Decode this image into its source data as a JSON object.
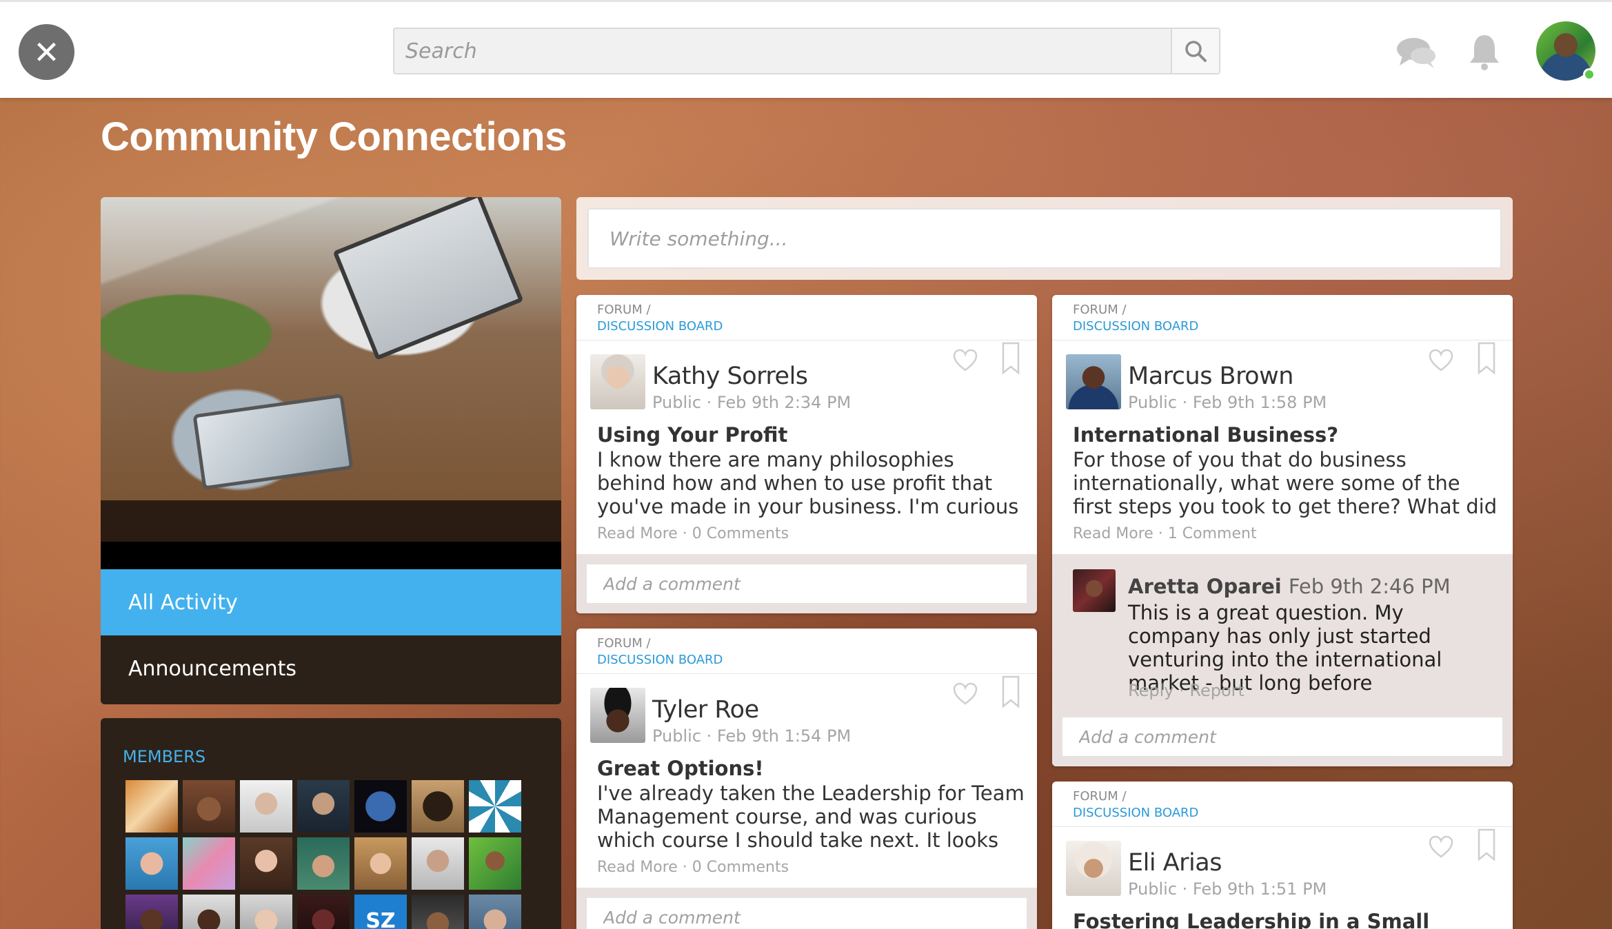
{
  "header": {
    "close_glyph": "✕",
    "search_placeholder": "Search"
  },
  "page_title": "Community Connections",
  "sidebar": {
    "nav": [
      {
        "label": "All Activity",
        "active": true
      },
      {
        "label": "Announcements",
        "active": false
      }
    ],
    "members_title": "MEMBERS",
    "member_initials_badge": "SZ"
  },
  "composer": {
    "placeholder": "Write something..."
  },
  "posts": [
    {
      "forum_label": "FORUM /",
      "board": "DISCUSSION BOARD",
      "author": "Kathy Sorrels",
      "meta": "Public · Feb 9th 2:34 PM",
      "title": "Using Your Profit",
      "body": "I know there are many philosophies behind how and when to use profit that you've made in your business. I'm curious what you",
      "links": "Read More · 0 Comments",
      "comment_placeholder": "Add a comment"
    },
    {
      "forum_label": "FORUM /",
      "board": "DISCUSSION BOARD",
      "author": "Tyler Roe",
      "meta": "Public · Feb 9th 1:54 PM",
      "title": "Great Options!",
      "body": "I've already taken the Leadership for Team Management course, and was curious which course I should take next. It looks like there's",
      "links": "Read More · 0 Comments",
      "comment_placeholder": "Add a comment"
    },
    {
      "forum_label": "FORUM /",
      "board": "DISCUSSION BOARD",
      "author": "Marcus Brown",
      "meta": "Public · Feb 9th 1:58 PM",
      "title": "International Business?",
      "body": "For those of you that do business internationally, what were some of the first steps you took to get there? What did you",
      "links": "Read More · 1 Comment",
      "reply": {
        "name": "Aretta Oparei",
        "time": "Feb 9th 2:46 PM",
        "body": "This is a great question. My company has only just started venturing into the international market - but long before",
        "links": "Reply · Report"
      },
      "comment_placeholder": "Add a comment"
    },
    {
      "forum_label": "FORUM /",
      "board": "DISCUSSION BOARD",
      "author": "Eli Arias",
      "meta": "Public · Feb 9th 1:51 PM",
      "title": "Fostering Leadership in a Small Business"
    }
  ],
  "icons": {
    "close": "close-icon",
    "search": "search-icon",
    "chat": "chat-icon",
    "notifications": "bell-icon",
    "like": "heart-icon",
    "save": "bookmark-icon"
  },
  "colors": {
    "accent": "#43b1ed",
    "link": "#2a9ad8",
    "panel": "#2c2118",
    "close_button": "#6e6e6e"
  }
}
